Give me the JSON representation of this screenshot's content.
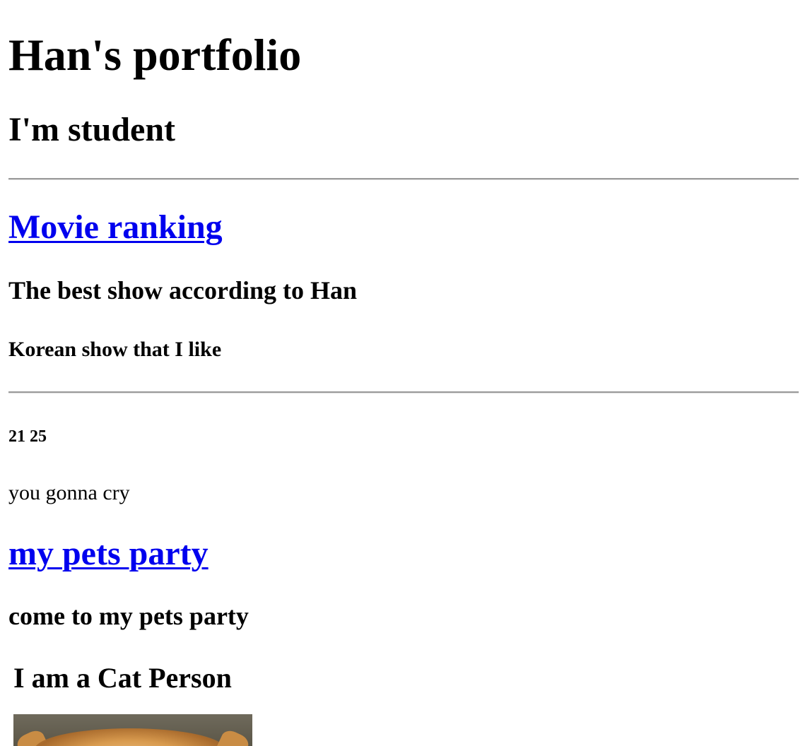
{
  "page": {
    "title": "Han's portfolio",
    "subtitle": "I'm student"
  },
  "movie_section": {
    "link_label": "Movie ranking",
    "heading": "The best show according to Han",
    "subheading": "Korean show that I like"
  },
  "show_section": {
    "show_title": "21 25",
    "tagline": "you gonna cry"
  },
  "pets_section": {
    "link_label": "my pets party",
    "heading": "come to my pets party",
    "cat_heading": "I am a Cat Person"
  },
  "colors": {
    "link": "#0000ee",
    "text": "#000000",
    "background": "#ffffff"
  }
}
